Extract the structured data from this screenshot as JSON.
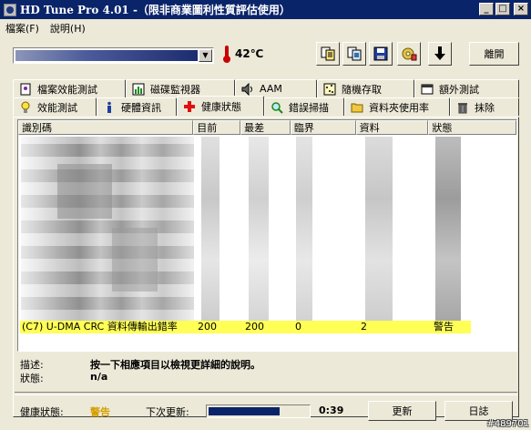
{
  "window": {
    "title": "HD Tune Pro 4.01 -（限非商業圖利性質評估使用）"
  },
  "menu": {
    "items": [
      "檔案(F)",
      "說明(H)"
    ]
  },
  "toolbar": {
    "drive_selected": "",
    "temperature": "42℃",
    "exit_label": "離開",
    "icons": [
      "copy-text-icon",
      "copy-screenshot-icon",
      "save-icon",
      "options-icon",
      "download-arrow-icon"
    ]
  },
  "tabs": {
    "row_top": [
      {
        "label": "檔案效能測試",
        "icon": "file-benchmark-icon"
      },
      {
        "label": "磁碟監視器",
        "icon": "disk-monitor-icon"
      },
      {
        "label": "AAM",
        "icon": "speaker-icon"
      },
      {
        "label": "隨機存取",
        "icon": "random-access-icon"
      },
      {
        "label": "額外測試",
        "icon": "extra-tests-icon"
      }
    ],
    "row_bottom": [
      {
        "label": "效能測試",
        "icon": "lightbulb-icon"
      },
      {
        "label": "硬體資訊",
        "icon": "info-icon"
      },
      {
        "label": "健康狀態",
        "icon": "health-cross-icon",
        "active": true
      },
      {
        "label": "錯誤掃描",
        "icon": "magnifier-icon"
      },
      {
        "label": "資料夾使用率",
        "icon": "folder-icon"
      },
      {
        "label": "抹除",
        "icon": "trash-icon"
      }
    ]
  },
  "table": {
    "columns": [
      "識別碼",
      "目前",
      "最差",
      "臨界",
      "資料",
      "狀態"
    ],
    "highlighted_row": {
      "id": "(C7) U-DMA CRC 資料傳輸出錯率",
      "current": "200",
      "worst": "200",
      "threshold": "0",
      "data": "2",
      "status": "警告"
    }
  },
  "details": {
    "desc_label": "描述:",
    "desc_value": "按一下相應項目以檢視更詳細的說明。",
    "status_label": "狀態:",
    "status_value": "n/a"
  },
  "footer": {
    "health_label": "健康狀態:",
    "health_value": "警告",
    "health_color": "#d4a000",
    "next_update_label": "下次更新:",
    "countdown": "0:39",
    "progress_fraction": 0.72,
    "refresh_label": "更新",
    "log_label": "日誌"
  },
  "watermark": "#489701"
}
